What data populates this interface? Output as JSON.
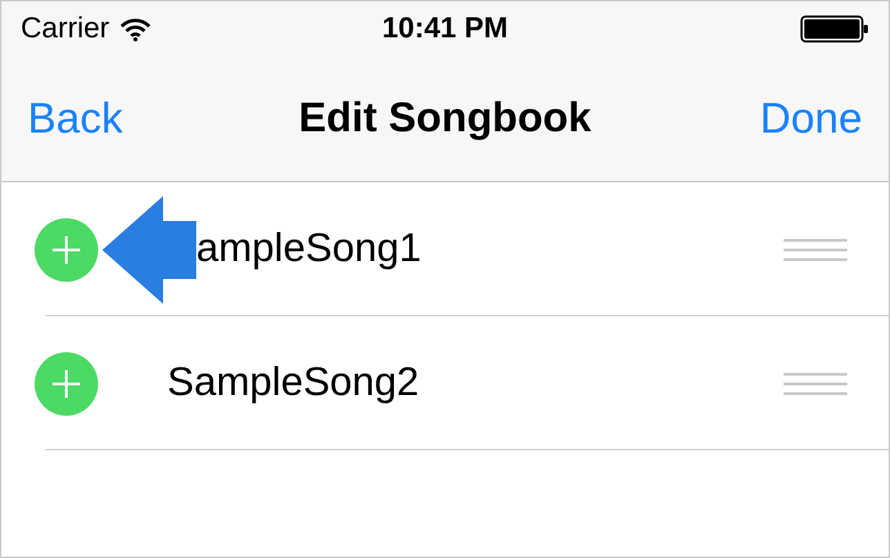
{
  "status_bar": {
    "carrier": "Carrier",
    "time": "10:41 PM"
  },
  "nav_bar": {
    "back": "Back",
    "title": "Edit Songbook",
    "done": "Done"
  },
  "rows": [
    {
      "kind": "pointed",
      "label": "ampleSong1"
    },
    {
      "kind": "plain",
      "label": "SampleSong2"
    }
  ]
}
